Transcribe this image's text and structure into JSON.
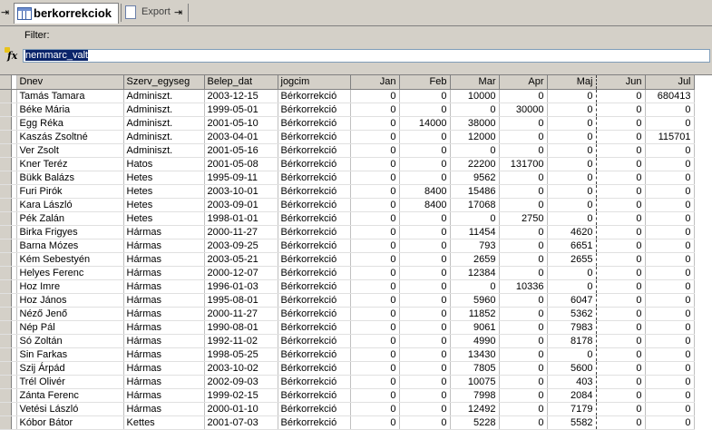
{
  "tabs": {
    "active_label": "berkorrekciok",
    "export_label": "Export"
  },
  "filter": {
    "label": "Filter:",
    "value": "nemmarc_valt"
  },
  "columns": [
    "Dnev",
    "Szerv_egyseg",
    "Belep_dat",
    "jogcim",
    "Jan",
    "Feb",
    "Mar",
    "Apr",
    "Maj",
    "Jun",
    "Jul"
  ],
  "rows": [
    [
      "Tamás Tamara",
      "Adminiszt.",
      "2003-12-15",
      "Bérkorrekció",
      "0",
      "0",
      "10000",
      "0",
      "0",
      "0",
      "680413"
    ],
    [
      "Béke Mária",
      "Adminiszt.",
      "1999-05-01",
      "Bérkorrekció",
      "0",
      "0",
      "0",
      "30000",
      "0",
      "0",
      "0"
    ],
    [
      "Egg Réka",
      "Adminiszt.",
      "2001-05-10",
      "Bérkorrekció",
      "0",
      "14000",
      "38000",
      "0",
      "0",
      "0",
      "0"
    ],
    [
      "Kaszás Zsoltné",
      "Adminiszt.",
      "2003-04-01",
      "Bérkorrekció",
      "0",
      "0",
      "12000",
      "0",
      "0",
      "0",
      "115701"
    ],
    [
      "Ver Zsolt",
      "Adminiszt.",
      "2001-05-16",
      "Bérkorrekció",
      "0",
      "0",
      "0",
      "0",
      "0",
      "0",
      "0"
    ],
    [
      "Kner Teréz",
      "Hatos",
      "2001-05-08",
      "Bérkorrekció",
      "0",
      "0",
      "22200",
      "131700",
      "0",
      "0",
      "0"
    ],
    [
      "Bükk Balázs",
      "Hetes",
      "1995-09-11",
      "Bérkorrekció",
      "0",
      "0",
      "9562",
      "0",
      "0",
      "0",
      "0"
    ],
    [
      "Furi Pirók",
      "Hetes",
      "2003-10-01",
      "Bérkorrekció",
      "0",
      "8400",
      "15486",
      "0",
      "0",
      "0",
      "0"
    ],
    [
      "Kara László",
      "Hetes",
      "2003-09-01",
      "Bérkorrekció",
      "0",
      "8400",
      "17068",
      "0",
      "0",
      "0",
      "0"
    ],
    [
      "Pék Zalán",
      "Hetes",
      "1998-01-01",
      "Bérkorrekció",
      "0",
      "0",
      "0",
      "2750",
      "0",
      "0",
      "0"
    ],
    [
      "Birka Frigyes",
      "Hármas",
      "2000-11-27",
      "Bérkorrekció",
      "0",
      "0",
      "11454",
      "0",
      "4620",
      "0",
      "0"
    ],
    [
      "Barna Mózes",
      "Hármas",
      "2003-09-25",
      "Bérkorrekció",
      "0",
      "0",
      "793",
      "0",
      "6651",
      "0",
      "0"
    ],
    [
      "Kém Sebestyén",
      "Hármas",
      "2003-05-21",
      "Bérkorrekció",
      "0",
      "0",
      "2659",
      "0",
      "2655",
      "0",
      "0"
    ],
    [
      "Helyes Ferenc",
      "Hármas",
      "2000-12-07",
      "Bérkorrekció",
      "0",
      "0",
      "12384",
      "0",
      "0",
      "0",
      "0"
    ],
    [
      "Hoz Imre",
      "Hármas",
      "1996-01-03",
      "Bérkorrekció",
      "0",
      "0",
      "0",
      "10336",
      "0",
      "0",
      "0"
    ],
    [
      "Hoz János",
      "Hármas",
      "1995-08-01",
      "Bérkorrekció",
      "0",
      "0",
      "5960",
      "0",
      "6047",
      "0",
      "0"
    ],
    [
      "Néző Jenő",
      "Hármas",
      "2000-11-27",
      "Bérkorrekció",
      "0",
      "0",
      "11852",
      "0",
      "5362",
      "0",
      "0"
    ],
    [
      "Nép Pál",
      "Hármas",
      "1990-08-01",
      "Bérkorrekció",
      "0",
      "0",
      "9061",
      "0",
      "7983",
      "0",
      "0"
    ],
    [
      "Só Zoltán",
      "Hármas",
      "1992-11-02",
      "Bérkorrekció",
      "0",
      "0",
      "4990",
      "0",
      "8178",
      "0",
      "0"
    ],
    [
      "Sin Farkas",
      "Hármas",
      "1998-05-25",
      "Bérkorrekció",
      "0",
      "0",
      "13430",
      "0",
      "0",
      "0",
      "0"
    ],
    [
      "Szij Árpád",
      "Hármas",
      "2003-10-02",
      "Bérkorrekció",
      "0",
      "0",
      "7805",
      "0",
      "5600",
      "0",
      "0"
    ],
    [
      "Trél Olivér",
      "Hármas",
      "2002-09-03",
      "Bérkorrekció",
      "0",
      "0",
      "10075",
      "0",
      "403",
      "0",
      "0"
    ],
    [
      "Zánta Ferenc",
      "Hármas",
      "1999-02-15",
      "Bérkorrekció",
      "0",
      "0",
      "7998",
      "0",
      "2084",
      "0",
      "0"
    ],
    [
      "Vetési László",
      "Hármas",
      "2000-01-10",
      "Bérkorrekció",
      "0",
      "0",
      "12492",
      "0",
      "7179",
      "0",
      "0"
    ],
    [
      "Kóbor Bátor",
      "Kettes",
      "2001-07-03",
      "Bérkorrekció",
      "0",
      "0",
      "5228",
      "0",
      "5582",
      "0",
      "0"
    ]
  ],
  "colors": {
    "selection": "#0a246a",
    "chrome": "#d4d0c8"
  }
}
